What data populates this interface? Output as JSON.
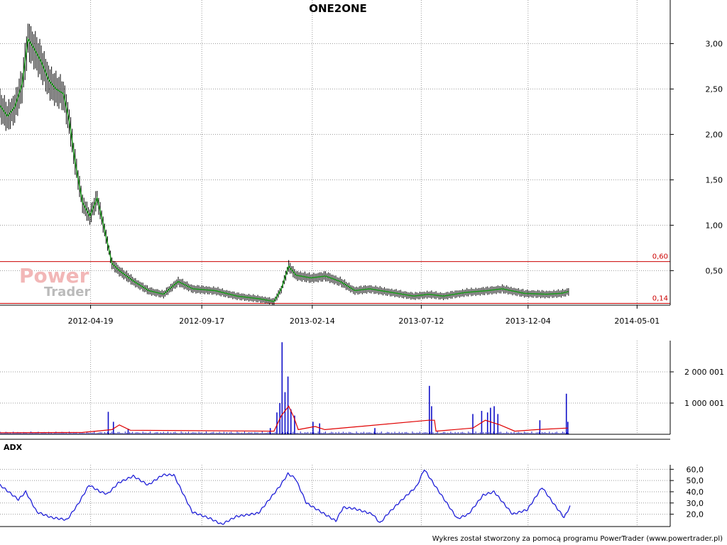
{
  "chart_data": [
    {
      "type": "candlestick",
      "title": "ONE2ONE",
      "x_ticks": [
        "2012-04-19",
        "2012-09-17",
        "2013-02-14",
        "2013-07-12",
        "2013-12-04",
        "2014-05-01"
      ],
      "y_ticks": [
        "0,50",
        "1,00",
        "1,50",
        "2,00",
        "2,50",
        "3,00"
      ],
      "ylim": [
        0.12,
        3.48
      ],
      "xlim": [
        "2011-12-18",
        "2014-06-15"
      ],
      "grid": true,
      "reference_lines": [
        {
          "label": "0,60",
          "value": 0.6,
          "color": "#cc0000"
        },
        {
          "label": "0,14",
          "value": 0.14,
          "color": "#cc0000"
        }
      ],
      "series": [
        {
          "name": "close",
          "points": [
            [
              "2011-12-18",
              2.32
            ],
            [
              "2011-12-28",
              2.2
            ],
            [
              "2012-01-07",
              2.3
            ],
            [
              "2012-01-17",
              2.55
            ],
            [
              "2012-01-25",
              3.05
            ],
            [
              "2012-02-02",
              2.95
            ],
            [
              "2012-02-12",
              2.8
            ],
            [
              "2012-02-22",
              2.6
            ],
            [
              "2012-03-03",
              2.5
            ],
            [
              "2012-03-13",
              2.45
            ],
            [
              "2012-03-21",
              2.15
            ],
            [
              "2012-03-29",
              1.7
            ],
            [
              "2012-04-08",
              1.25
            ],
            [
              "2012-04-18",
              1.1
            ],
            [
              "2012-04-28",
              1.3
            ],
            [
              "2012-05-08",
              0.95
            ],
            [
              "2012-05-18",
              0.58
            ],
            [
              "2012-05-28",
              0.5
            ],
            [
              "2012-06-17",
              0.38
            ],
            [
              "2012-07-07",
              0.28
            ],
            [
              "2012-07-27",
              0.24
            ],
            [
              "2012-08-16",
              0.38
            ],
            [
              "2012-09-05",
              0.3
            ],
            [
              "2012-10-05",
              0.28
            ],
            [
              "2012-11-04",
              0.22
            ],
            [
              "2012-12-04",
              0.19
            ],
            [
              "2012-12-24",
              0.16
            ],
            [
              "2013-01-03",
              0.3
            ],
            [
              "2013-01-13",
              0.55
            ],
            [
              "2013-01-23",
              0.45
            ],
            [
              "2013-02-12",
              0.42
            ],
            [
              "2013-03-04",
              0.44
            ],
            [
              "2013-03-24",
              0.38
            ],
            [
              "2013-04-13",
              0.28
            ],
            [
              "2013-05-03",
              0.3
            ],
            [
              "2013-06-02",
              0.26
            ],
            [
              "2013-07-02",
              0.22
            ],
            [
              "2013-07-22",
              0.24
            ],
            [
              "2013-08-11",
              0.22
            ],
            [
              "2013-09-10",
              0.26
            ],
            [
              "2013-10-10",
              0.28
            ],
            [
              "2013-10-30",
              0.3
            ],
            [
              "2013-11-29",
              0.25
            ],
            [
              "2013-12-29",
              0.24
            ],
            [
              "2014-01-18",
              0.25
            ],
            [
              "2014-01-28",
              0.27
            ]
          ]
        }
      ]
    },
    {
      "type": "bar",
      "y_ticks": [
        "1 000 001",
        "2 000 001"
      ],
      "ylim": [
        0,
        3000000
      ],
      "grid": true,
      "series": [
        {
          "name": "volume",
          "points": [
            [
              "2012-05-13",
              720000
            ],
            [
              "2012-05-20",
              400000
            ],
            [
              "2012-06-09",
              180000
            ],
            [
              "2012-12-19",
              200000
            ],
            [
              "2012-12-28",
              700000
            ],
            [
              "2013-01-01",
              1000000
            ],
            [
              "2013-01-04",
              2950000
            ],
            [
              "2013-01-08",
              1350000
            ],
            [
              "2013-01-12",
              1850000
            ],
            [
              "2013-01-16",
              800000
            ],
            [
              "2013-01-21",
              600000
            ],
            [
              "2013-02-15",
              400000
            ],
            [
              "2013-02-24",
              350000
            ],
            [
              "2013-05-10",
              200000
            ],
            [
              "2013-07-23",
              1550000
            ],
            [
              "2013-07-26",
              900000
            ],
            [
              "2013-09-20",
              650000
            ],
            [
              "2013-10-02",
              750000
            ],
            [
              "2013-10-10",
              700000
            ],
            [
              "2013-10-14",
              850000
            ],
            [
              "2013-10-19",
              900000
            ],
            [
              "2013-10-24",
              650000
            ],
            [
              "2013-12-20",
              450000
            ],
            [
              "2014-01-25",
              1300000
            ],
            [
              "2014-01-27",
              400000
            ]
          ]
        },
        {
          "name": "volume-average",
          "points": [
            [
              "2011-12-18",
              50000
            ],
            [
              "2012-04-08",
              60000
            ],
            [
              "2012-05-18",
              150000
            ],
            [
              "2012-05-28",
              300000
            ],
            [
              "2012-06-12",
              130000
            ],
            [
              "2012-12-24",
              100000
            ],
            [
              "2013-01-03",
              600000
            ],
            [
              "2013-01-13",
              900000
            ],
            [
              "2013-01-20",
              550000
            ],
            [
              "2013-01-26",
              150000
            ],
            [
              "2013-02-18",
              250000
            ],
            [
              "2013-03-03",
              150000
            ],
            [
              "2013-07-22",
              450000
            ],
            [
              "2013-07-30",
              450000
            ],
            [
              "2013-08-01",
              100000
            ],
            [
              "2013-09-20",
              200000
            ],
            [
              "2013-10-07",
              450000
            ],
            [
              "2013-10-27",
              300000
            ],
            [
              "2013-11-16",
              100000
            ],
            [
              "2013-12-16",
              150000
            ],
            [
              "2014-01-27",
              200000
            ]
          ]
        }
      ]
    },
    {
      "type": "line",
      "title": "ADX",
      "y_ticks": [
        "20,0",
        "30,0",
        "40,0",
        "50,0",
        "60,0"
      ],
      "ylim": [
        9,
        64
      ],
      "grid": true,
      "series": [
        {
          "name": "ADX",
          "points": [
            [
              "2011-12-18",
              46
            ],
            [
              "2012-01-12",
              33
            ],
            [
              "2012-01-22",
              40
            ],
            [
              "2012-02-06",
              22
            ],
            [
              "2012-02-26",
              17
            ],
            [
              "2012-03-18",
              15
            ],
            [
              "2012-04-02",
              29
            ],
            [
              "2012-04-17",
              46
            ],
            [
              "2012-05-02",
              40
            ],
            [
              "2012-05-12",
              38
            ],
            [
              "2012-05-27",
              48
            ],
            [
              "2012-06-16",
              54
            ],
            [
              "2012-07-06",
              46
            ],
            [
              "2012-07-26",
              55
            ],
            [
              "2012-08-10",
              55
            ],
            [
              "2012-09-04",
              22
            ],
            [
              "2012-09-29",
              16
            ],
            [
              "2012-10-14",
              11
            ],
            [
              "2012-11-03",
              18
            ],
            [
              "2012-12-03",
              21
            ],
            [
              "2013-01-01",
              45
            ],
            [
              "2013-01-12",
              56
            ],
            [
              "2013-01-22",
              52
            ],
            [
              "2013-02-06",
              30
            ],
            [
              "2013-02-26",
              22
            ],
            [
              "2013-03-18",
              14
            ],
            [
              "2013-03-28",
              26
            ],
            [
              "2013-04-12",
              25
            ],
            [
              "2013-05-07",
              20
            ],
            [
              "2013-05-17",
              12
            ],
            [
              "2013-05-27",
              20
            ],
            [
              "2013-06-16",
              33
            ],
            [
              "2013-07-06",
              45
            ],
            [
              "2013-07-16",
              60
            ],
            [
              "2013-07-31",
              45
            ],
            [
              "2013-08-30",
              16
            ],
            [
              "2013-09-14",
              20
            ],
            [
              "2013-10-04",
              37
            ],
            [
              "2013-10-19",
              40
            ],
            [
              "2013-11-13",
              20
            ],
            [
              "2013-12-03",
              24
            ],
            [
              "2013-12-23",
              44
            ],
            [
              "2014-01-07",
              30
            ],
            [
              "2014-01-22",
              17
            ],
            [
              "2014-01-30",
              27
            ]
          ]
        }
      ]
    }
  ],
  "watermark": {
    "line1": "Power",
    "line2": "Trader"
  },
  "footer": "Wykres został stworzony za pomocą programu PowerTrader (www.powertrader.pl)"
}
